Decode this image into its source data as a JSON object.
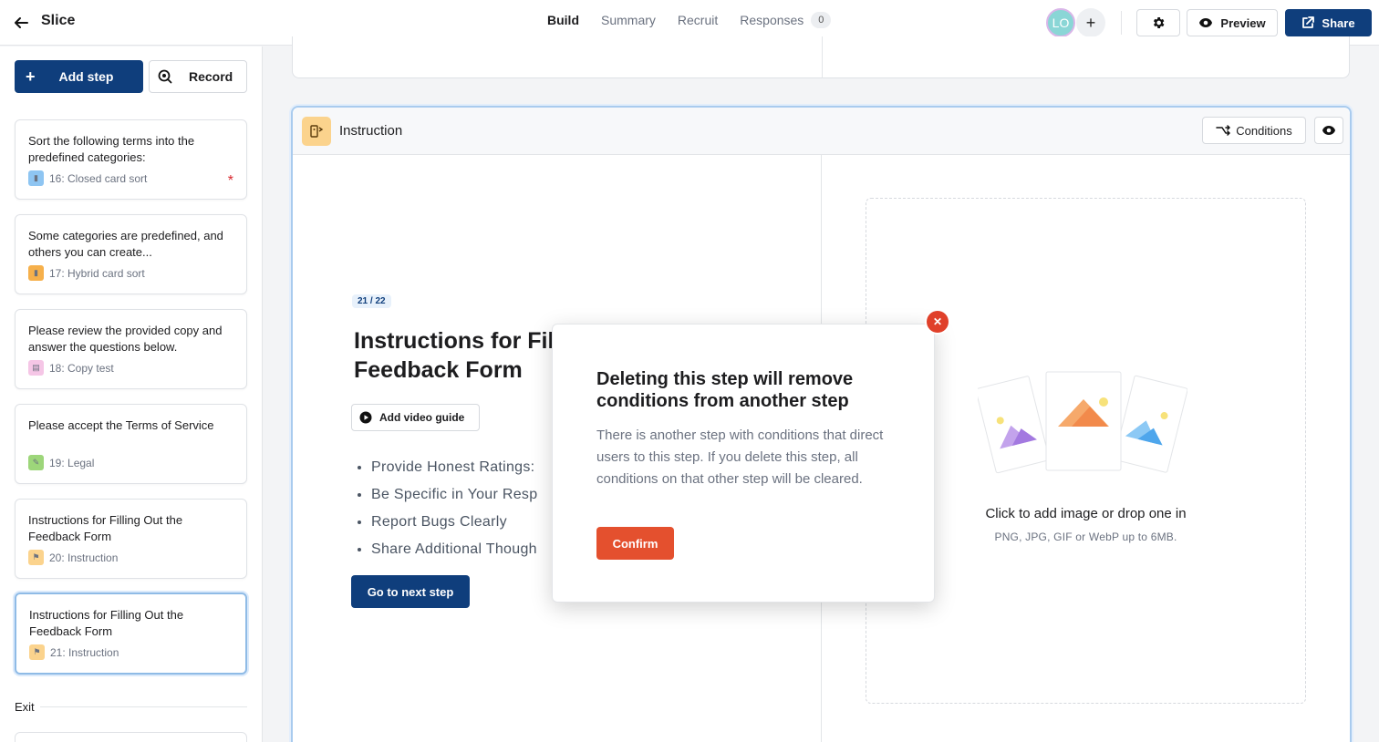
{
  "header": {
    "app_title": "Slice",
    "tabs": [
      {
        "label": "Build",
        "active": true
      },
      {
        "label": "Summary",
        "active": false
      },
      {
        "label": "Recruit",
        "active": false
      },
      {
        "label": "Responses",
        "count": "0",
        "active": false
      }
    ],
    "avatar_initials": "LO",
    "add_collaborator": "+",
    "preview_label": "Preview",
    "share_label": "Share",
    "icons": {
      "back": "arrow-left-icon",
      "settings": "gear-icon",
      "preview": "eye-icon",
      "share": "external-link-icon"
    }
  },
  "sidebar": {
    "add_step_label": "Add step",
    "record_label": "Record",
    "steps": [
      {
        "title": "Sort the following terms into the predefined categories:",
        "meta": "16: Closed card sort",
        "icon_color": "#8ec5f2",
        "required": true
      },
      {
        "title": "Some categories are predefined, and others you can create...",
        "meta": "17: Hybrid card sort",
        "icon_color": "#f6b04b",
        "required": false
      },
      {
        "title": "Please review the provided copy and answer the questions below.",
        "meta": "18: Copy test",
        "icon_color": "#f5c6e6",
        "required": false
      },
      {
        "title": "Please accept the Terms of Service",
        "meta": "19: Legal",
        "icon_color": "#9dd67a",
        "required": false
      },
      {
        "title": "Instructions for Filling Out the Feedback Form",
        "meta": "20: Instruction",
        "icon_color": "#fbd38d",
        "required": false
      },
      {
        "title": "Instructions for Filling Out the Feedback Form",
        "meta": "21: Instruction",
        "icon_color": "#fbd38d",
        "required": false,
        "selected": true
      }
    ],
    "required_mark": "*",
    "exit_label": "Exit"
  },
  "card": {
    "header_title": "Instruction",
    "conditions_label": "Conditions",
    "step_badge": "21 / 22",
    "title": "Instructions for Filling Out the Feedback Form",
    "title_line1": "Instructions for Filli",
    "title_line2": "Feedback Form",
    "video_guide_label": "Add video guide",
    "bullets": [
      "Provide Honest Ratings:",
      "Be Specific in Your Resp",
      "Report Bugs Clearly",
      "Share Additional Though"
    ],
    "next_label": "Go to next step",
    "dropzone_title": "Click to add image or drop one in",
    "dropzone_sub": "PNG, JPG, GIF or WebP up to 6MB."
  },
  "modal": {
    "title": "Deleting this step will remove conditions from another step",
    "body": "There is another step with conditions that direct users to this step. If you delete this step, all conditions on that other step will be cleared.",
    "confirm_label": "Confirm",
    "close_icon": "close-icon"
  },
  "colors": {
    "primary": "#0f3e7c",
    "danger": "#e4502e",
    "selection": "#a9cbee"
  }
}
